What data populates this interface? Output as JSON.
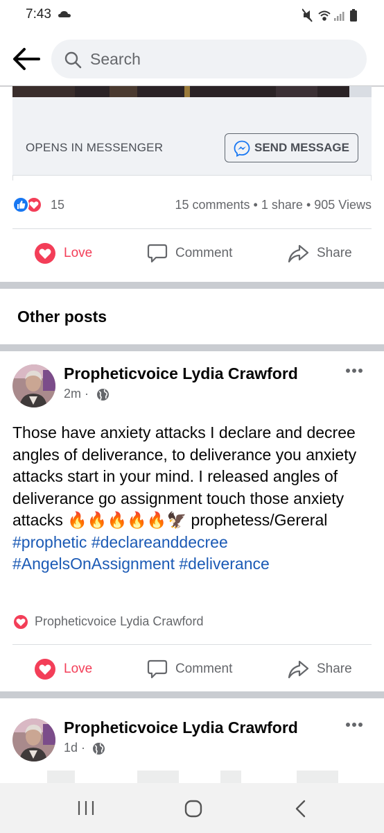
{
  "status_bar": {
    "time": "7:43",
    "icons": [
      "cloud-icon",
      "mute-icon",
      "wifi-icon",
      "signal-icon",
      "battery-icon"
    ]
  },
  "header": {
    "search_placeholder": "Search",
    "icons": [
      "back-arrow-icon",
      "search-icon"
    ]
  },
  "shared_post": {
    "opens_in_label": "OPENS IN MESSENGER",
    "send_message_label": "SEND MESSAGE",
    "reaction_count": "15",
    "comments": "15 comments",
    "shares": "1 share",
    "views": "905 Views",
    "separator": "•"
  },
  "actions": {
    "love_label": "Love",
    "comment_label": "Comment",
    "share_label": "Share"
  },
  "other_posts": {
    "title": "Other posts",
    "posts": [
      {
        "author": "Propheticvoice Lydia Crawford",
        "time": "2m",
        "time_separator": "·",
        "body_text": "Those have anxiety attacks I declare and decree angles of deliverance, to deliverance you anxiety attacks start in your mind. I released angles of deliverance go assignment touch those anxiety attacks 🔥🔥🔥🔥🔥🦅 prophetess/Gereral ",
        "hashtags": [
          "#prophetic",
          "#declareanddecree",
          "#AngelsOnAssignment",
          "#deliverance"
        ],
        "loved_by": "Propheticvoice Lydia Crawford"
      },
      {
        "author": "Propheticvoice Lydia Crawford",
        "time": "1d",
        "time_separator": "·"
      }
    ]
  },
  "colors": {
    "accent_blue": "#1877f2",
    "love_red": "#f33e58",
    "hashtag_blue": "#1b5ab5",
    "muted_text": "#65676b",
    "separator_gray": "#c9ccd1"
  },
  "system_nav": {
    "icons": [
      "recents-icon",
      "home-icon",
      "back-icon"
    ]
  }
}
